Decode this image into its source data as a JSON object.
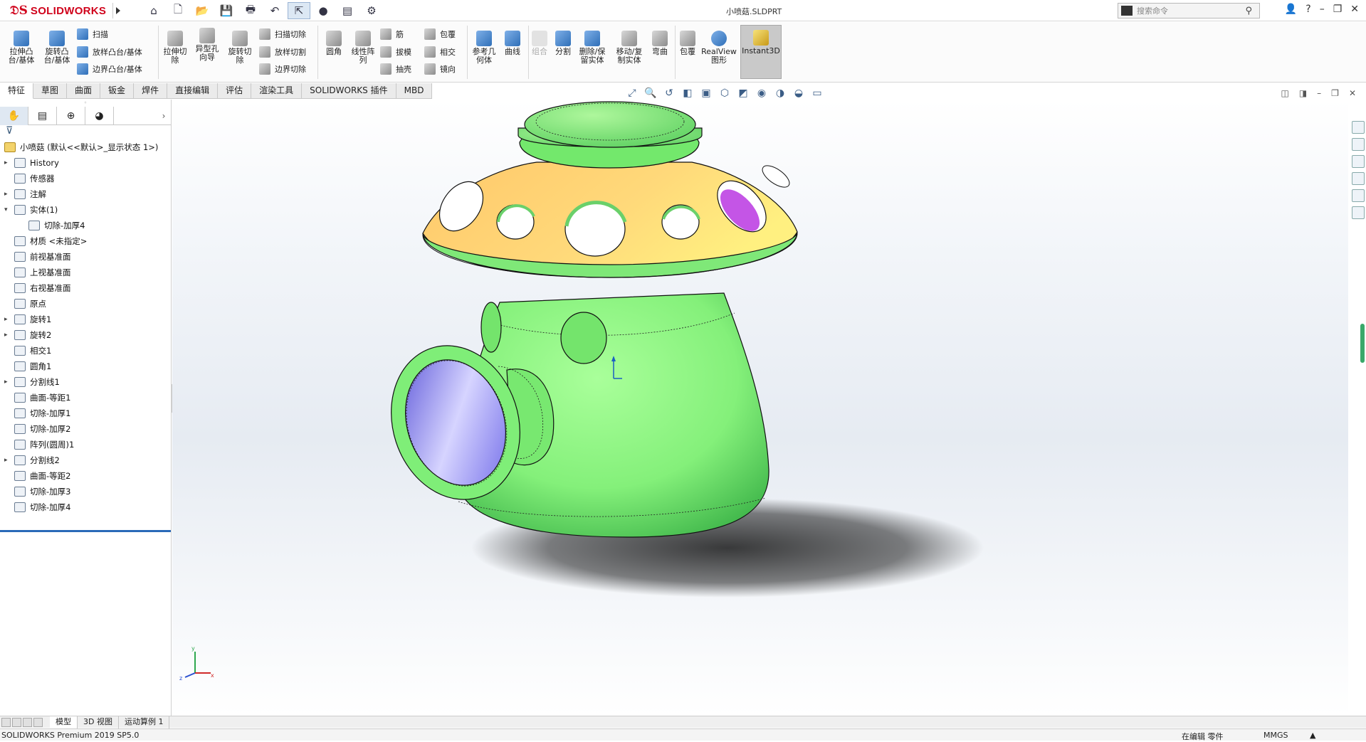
{
  "app": {
    "brand": "SOLIDWORKS",
    "document_title": "小喷菇.SLDPRT",
    "search_placeholder": "搜索命令"
  },
  "ribbon": {
    "extrude_boss": "拉伸凸\n台/基体",
    "revolve_boss": "旋转凸\n台/基体",
    "sweep": "扫描",
    "loft_boss": "放样凸台/基体",
    "boundary_boss": "边界凸台/基体",
    "extrude_cut": "拉伸切\n除",
    "hole_wizard": "异型孔\n向导",
    "revolve_cut": "旋转切\n除",
    "sweep_cut": "扫描切除",
    "loft_cut": "放样切割",
    "boundary_cut": "边界切除",
    "fillet": "圆角",
    "linear_pattern": "线性阵\n列",
    "rib": "筋",
    "draft": "拔模",
    "shell": "抽壳",
    "wrap": "包覆",
    "intersect": "相交",
    "mirror": "镜向",
    "ref_geometry": "参考几\n何体",
    "curves": "曲线",
    "combine": "组合",
    "split": "分割",
    "delete_keep_body": "删除/保\n留实体",
    "move_copy_body": "移动/复\n制实体",
    "flex": "弯曲",
    "wrap2": "包覆",
    "realview": "RealView\n图形",
    "instant3d": "Instant3D"
  },
  "tabs": [
    "特征",
    "草图",
    "曲面",
    "钣金",
    "焊件",
    "直接编辑",
    "评估",
    "渲染工具",
    "SOLIDWORKS 插件",
    "MBD"
  ],
  "feature_tree": {
    "root": "小喷菇  (默认<<默认>_显示状态 1>)",
    "items": [
      {
        "label": "History",
        "expand": "▸",
        "indent": 0
      },
      {
        "label": "传感器",
        "expand": "",
        "indent": 0
      },
      {
        "label": "注解",
        "expand": "▸",
        "indent": 0
      },
      {
        "label": "实体(1)",
        "expand": "▾",
        "indent": 0
      },
      {
        "label": "切除-加厚4",
        "expand": "",
        "indent": 1
      },
      {
        "label": "材质 <未指定>",
        "expand": "",
        "indent": 0
      },
      {
        "label": "前视基准面",
        "expand": "",
        "indent": 0
      },
      {
        "label": "上视基准面",
        "expand": "",
        "indent": 0
      },
      {
        "label": "右视基准面",
        "expand": "",
        "indent": 0
      },
      {
        "label": "原点",
        "expand": "",
        "indent": 0
      },
      {
        "label": "旋转1",
        "expand": "▸",
        "indent": 0
      },
      {
        "label": "旋转2",
        "expand": "▸",
        "indent": 0
      },
      {
        "label": "相交1",
        "expand": "",
        "indent": 0
      },
      {
        "label": "圆角1",
        "expand": "",
        "indent": 0
      },
      {
        "label": "分割线1",
        "expand": "▸",
        "indent": 0
      },
      {
        "label": "曲面-等距1",
        "expand": "",
        "indent": 0
      },
      {
        "label": "切除-加厚1",
        "expand": "",
        "indent": 0
      },
      {
        "label": "切除-加厚2",
        "expand": "",
        "indent": 0
      },
      {
        "label": "阵列(圆周)1",
        "expand": "",
        "indent": 0
      },
      {
        "label": "分割线2",
        "expand": "▸",
        "indent": 0
      },
      {
        "label": "曲面-等距2",
        "expand": "",
        "indent": 0
      },
      {
        "label": "切除-加厚3",
        "expand": "",
        "indent": 0
      },
      {
        "label": "切除-加厚4",
        "expand": "",
        "indent": 0
      }
    ]
  },
  "bottom_tabs": [
    "模型",
    "3D 视图",
    "运动算例 1"
  ],
  "status": {
    "version": "SOLIDWORKS Premium 2019 SP5.0",
    "editing": "在编辑 零件",
    "units": "MMGS",
    "caret": "▲"
  },
  "triad": {
    "x": "x",
    "y": "y",
    "z": "z"
  },
  "colors": {
    "body_green": "#84f07a",
    "cap_yellow": "#ffd870",
    "inner_purple": "#7f78ee",
    "hole_magenta": "#c455e6",
    "accent_blue": "#2a6ab8"
  }
}
